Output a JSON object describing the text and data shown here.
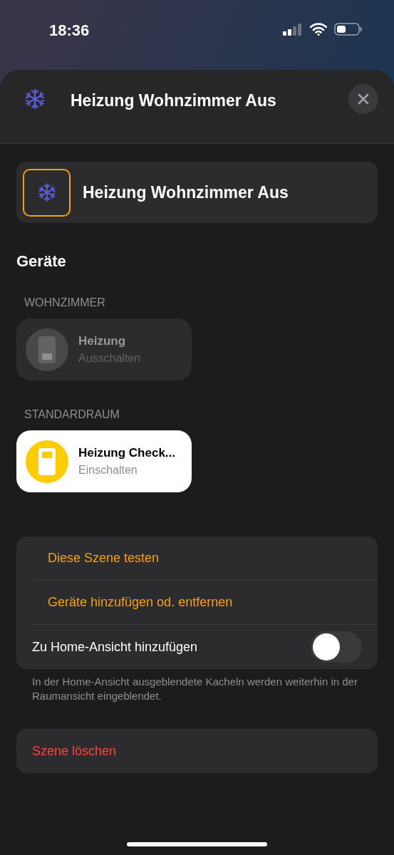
{
  "status_bar": {
    "time": "18:36"
  },
  "header": {
    "title": "Heizung Wohnzimmer Aus"
  },
  "scene": {
    "name": "Heizung Wohnzimmer Aus"
  },
  "devices_section": {
    "title": "Geräte"
  },
  "rooms": [
    {
      "name": "WOHNZIMMER",
      "devices": [
        {
          "name": "Heizung",
          "action": "Ausschalten",
          "on": false
        }
      ]
    },
    {
      "name": "STANDARDRAUM",
      "devices": [
        {
          "name": "Heizung Check...",
          "action": "Einschalten",
          "on": true
        }
      ]
    }
  ],
  "actions": [
    {
      "kind": "action",
      "label": "Diese Szene testen"
    },
    {
      "kind": "action",
      "label": "Geräte hinzufügen od. entfernen"
    },
    {
      "kind": "toggle",
      "label": "Zu Home-Ansicht hinzufügen",
      "on": false
    }
  ],
  "actions_footnote": "In der Home-Ansicht ausgeblendete Kacheln werden weiterhin in der Raumansicht eingeblendet.",
  "delete": {
    "kind": "destructive",
    "label": "Szene löschen"
  }
}
